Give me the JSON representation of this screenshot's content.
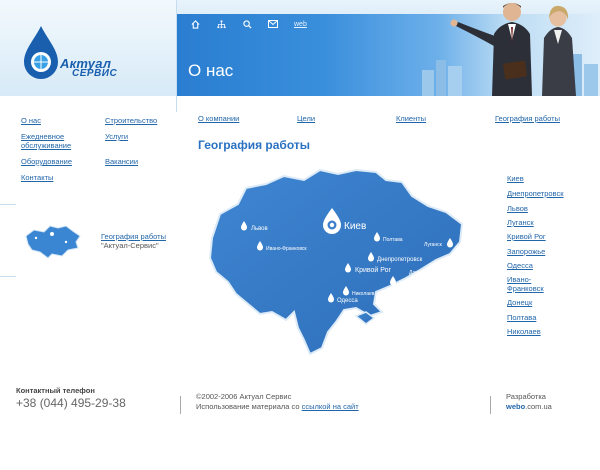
{
  "brand": {
    "name_line1": "Актуал",
    "name_line2": "СЕРВИС"
  },
  "header": {
    "page_title": "О нас",
    "icons": [
      "home-icon",
      "sitemap-icon",
      "search-icon",
      "mail-icon"
    ],
    "web_link": "web"
  },
  "left_nav": {
    "items": [
      {
        "label": "О нас"
      },
      {
        "label": "Строительство"
      },
      {
        "label": "Ежедневное обслуживание"
      },
      {
        "label": "Услуги"
      },
      {
        "label": "Оборудование"
      },
      {
        "label": "Вакансии"
      },
      {
        "label": "Контакты"
      }
    ]
  },
  "thumb": {
    "link": "География работы",
    "caption": "\"Актуал-Сервис\""
  },
  "tabs": [
    {
      "label": "О компании"
    },
    {
      "label": "Цели"
    },
    {
      "label": "Клиенты"
    },
    {
      "label": "География работы"
    }
  ],
  "section_title": "География работы",
  "map": {
    "capital": "Киев",
    "cities": [
      {
        "label": "Львов"
      },
      {
        "label": "Ивано-Франковск"
      },
      {
        "label": "Полтава"
      },
      {
        "label": "Луганск"
      },
      {
        "label": "Днепропетровск"
      },
      {
        "label": "Кривой Рог"
      },
      {
        "label": "Донецк"
      },
      {
        "label": "Запорожье"
      },
      {
        "label": "Николаев"
      },
      {
        "label": "Одесса"
      }
    ]
  },
  "city_list": [
    "Киев",
    "Днепропетровск",
    "Львов",
    "Луганск",
    "Кривой Рог",
    "Запорожье",
    "Одесса",
    "Ивано-Франковск",
    "Донецк",
    "Полтава",
    "Николаев"
  ],
  "footer": {
    "contact_label": "Контактный телефон",
    "phone": "+38 (044) 495-29-38",
    "copyright": "©2002-2006 Актуал Сервис",
    "usage_text": "Использование материала со",
    "usage_link": "ссылкой на сайт",
    "dev_label": "Разработка",
    "dev_brand": "webo",
    "dev_domain": ".com.ua"
  },
  "colors": {
    "accent": "#2a71c2",
    "link": "#2266aa",
    "header_blue": "#2a7dd0",
    "map_blue": "#3b7fcb"
  }
}
